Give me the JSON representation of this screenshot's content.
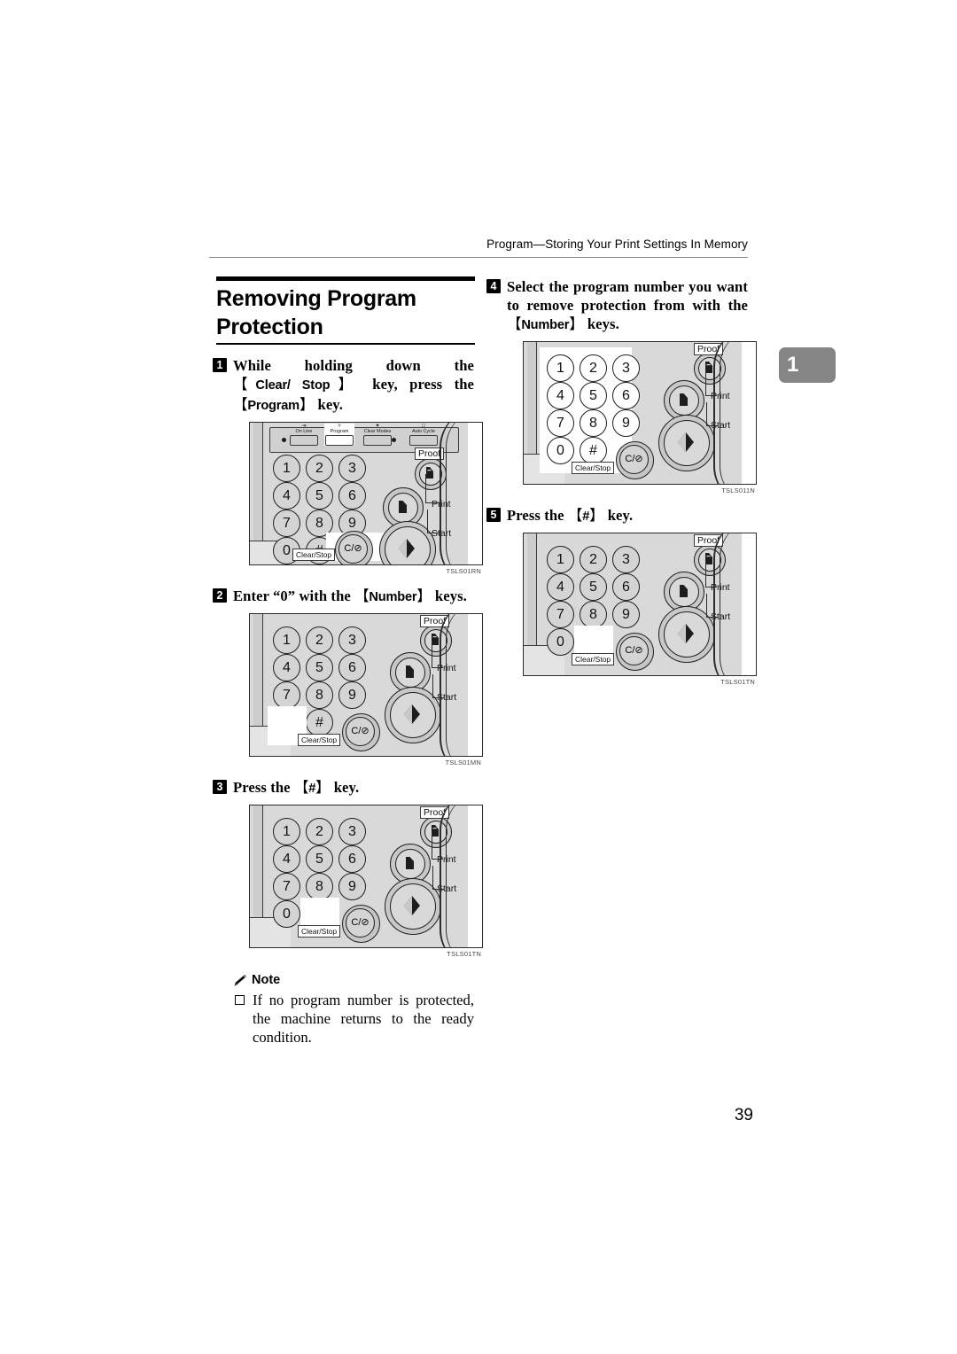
{
  "header": {
    "running_title": "Program—Storing Your Print Settings In Memory"
  },
  "section": {
    "title": "Removing Program Protection"
  },
  "edge_tab": {
    "label": "1"
  },
  "page": {
    "number": "39"
  },
  "steps": [
    {
      "num": "1",
      "text_parts": [
        "While holding down the ",
        "Clear/ Stop",
        " key, press the ",
        "Program",
        " key."
      ],
      "plain": "While holding down the [Clear/Stop] key, press the [Program] key.",
      "figure": {
        "code": "TSLS01RN",
        "type": "control-panel-full",
        "highlight": [
          "Program",
          "Clear/Stop"
        ]
      }
    },
    {
      "num": "2",
      "text_parts": [
        "Enter “0” with the ",
        "Number",
        " keys."
      ],
      "plain": "Enter “0” with the [Number] keys.",
      "figure": {
        "code": "TSLS01MN",
        "type": "keypad",
        "highlight": [
          "0"
        ]
      }
    },
    {
      "num": "3",
      "text_parts": [
        "Press the ",
        "#",
        " key."
      ],
      "plain": "Press the [#] key.",
      "figure": {
        "code": "TSLS01TN",
        "type": "keypad",
        "highlight": [
          "#"
        ]
      }
    },
    {
      "num": "4",
      "text_parts": [
        "Select the program number you want to remove protection from with the ",
        "Number",
        " keys."
      ],
      "plain": "Select the program number you want to remove protection from with the [Number] keys.",
      "figure": {
        "code": "TSLS011N",
        "type": "keypad",
        "highlight": [
          "all-number-keys"
        ]
      }
    },
    {
      "num": "5",
      "text_parts": [
        "Press the ",
        "#",
        " key."
      ],
      "plain": "Press the [#] key.",
      "figure": {
        "code": "TSLS01TN",
        "type": "keypad",
        "highlight": [
          "#"
        ]
      }
    }
  ],
  "note": {
    "icon": "pencil-icon",
    "heading": "Note",
    "items": [
      "If no program number is protected, the machine returns to the ready condition."
    ]
  },
  "panel": {
    "function_buttons": [
      {
        "label": "On Line",
        "glyph": "⇥"
      },
      {
        "label": "Program",
        "glyph": "✧"
      },
      {
        "label": "Clear Modes",
        "glyph": "✦"
      },
      {
        "label": "Auto Cycle",
        "glyph": "□"
      }
    ],
    "number_keys": [
      "1",
      "2",
      "3",
      "4",
      "5",
      "6",
      "7",
      "8",
      "9",
      "0",
      "#"
    ],
    "key5_sub": "○",
    "clear_stop": {
      "face": "C/⊘",
      "label": "Clear/Stop"
    },
    "cluster_labels": {
      "proof": "Proof",
      "print": "Print",
      "start": "Start"
    }
  }
}
